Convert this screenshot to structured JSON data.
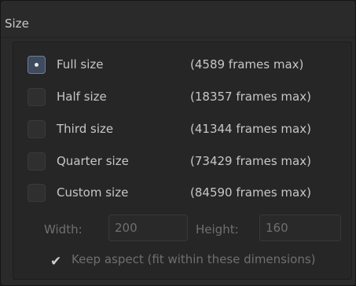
{
  "section": {
    "title": "Size"
  },
  "options": [
    {
      "label": "Full size",
      "frames": "(4589 frames max)",
      "checked": true
    },
    {
      "label": "Half size",
      "frames": "(18357 frames max)",
      "checked": false
    },
    {
      "label": "Third size",
      "frames": "(41344 frames max)",
      "checked": false
    },
    {
      "label": "Quarter size",
      "frames": "(73429 frames max)",
      "checked": false
    },
    {
      "label": "Custom size",
      "frames": "(84590 frames max)",
      "checked": false
    }
  ],
  "custom": {
    "width_label": "Width:",
    "width_value": "200",
    "height_label": "Height:",
    "height_value": "160",
    "keep_aspect_label": "Keep aspect (fit within these dimensions)",
    "keep_aspect_checked": true,
    "enabled": false
  },
  "colors": {
    "panel_bg": "#2a2a2a",
    "selected_radio": "#3f4a5c",
    "text": "#c7c7c7",
    "disabled_text": "#6f6f6f"
  },
  "icons": {
    "check": "checkmark-icon"
  }
}
